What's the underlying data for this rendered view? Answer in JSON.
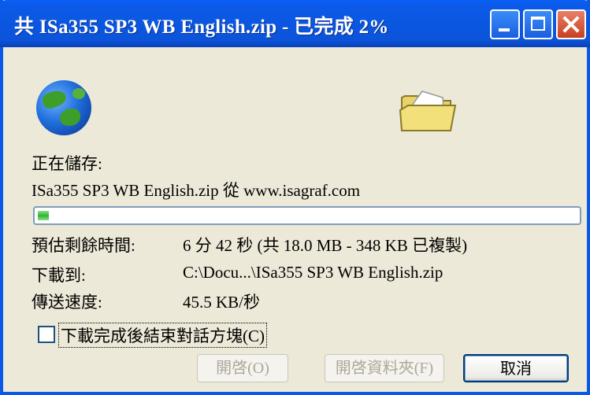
{
  "window": {
    "title": "共 ISa355 SP3 WB English.zip - 已完成 2%",
    "accent_color": "#0A58E8",
    "title_buttons": [
      "minimize",
      "maximize",
      "close"
    ]
  },
  "icons": {
    "source": "globe-icon",
    "destination": "folder-icon"
  },
  "status": {
    "saving_label": "正在儲存:",
    "file_source": "ISa355 SP3 WB English.zip 從 www.isagraf.com",
    "progress_percent": 2
  },
  "details": {
    "time_left_label": "預估剩餘時間:",
    "time_left_value": "6 分 42 秒 (共 18.0 MB - 348 KB 已複製)",
    "download_to_label": "下載到:",
    "download_to_value": "C:\\Docu...\\ISa355 SP3 WB English.zip",
    "transfer_rate_label": "傳送速度:",
    "transfer_rate_value": "45.5 KB/秒"
  },
  "options": {
    "close_when_done_label": "下載完成後結束對話方塊(C)",
    "close_when_done_checked": false
  },
  "buttons": {
    "open": "開啓(O)",
    "open_folder": "開啓資料夾(F)",
    "cancel": "取消"
  }
}
